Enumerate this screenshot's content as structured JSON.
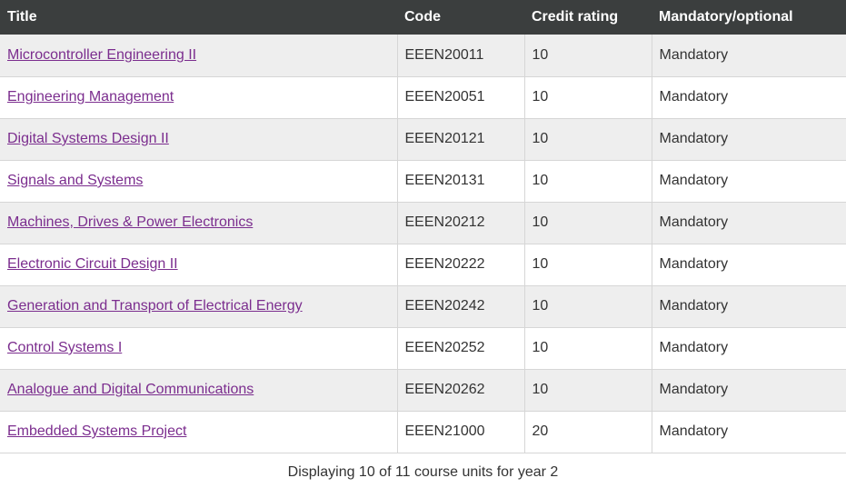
{
  "table": {
    "columns": [
      {
        "key": "title",
        "label": "Title"
      },
      {
        "key": "code",
        "label": "Code"
      },
      {
        "key": "credit",
        "label": "Credit rating"
      },
      {
        "key": "mand",
        "label": "Mandatory/optional"
      }
    ],
    "rows": [
      {
        "title": "Microcontroller Engineering II",
        "code": "EEEN20011",
        "credit": "10",
        "mand": "Mandatory"
      },
      {
        "title": "Engineering Management",
        "code": "EEEN20051",
        "credit": "10",
        "mand": "Mandatory"
      },
      {
        "title": "Digital Systems Design II",
        "code": "EEEN20121",
        "credit": "10",
        "mand": "Mandatory"
      },
      {
        "title": "Signals and Systems",
        "code": "EEEN20131",
        "credit": "10",
        "mand": "Mandatory"
      },
      {
        "title": "Machines, Drives & Power Electronics",
        "code": "EEEN20212",
        "credit": "10",
        "mand": "Mandatory"
      },
      {
        "title": "Electronic Circuit Design II",
        "code": "EEEN20222",
        "credit": "10",
        "mand": "Mandatory"
      },
      {
        "title": "Generation and Transport of Electrical Energy",
        "code": "EEEN20242",
        "credit": "10",
        "mand": "Mandatory"
      },
      {
        "title": "Control Systems I",
        "code": "EEEN20252",
        "credit": "10",
        "mand": "Mandatory"
      },
      {
        "title": "Analogue and Digital Communications",
        "code": "EEEN20262",
        "credit": "10",
        "mand": "Mandatory"
      },
      {
        "title": "Embedded Systems Project",
        "code": "EEEN21000",
        "credit": "20",
        "mand": "Mandatory"
      }
    ],
    "caption": "Displaying 10 of 11 course units for year 2"
  },
  "colors": {
    "header_background": "#3b3e3e",
    "header_text": "#ffffff",
    "link": "#7b2d8e",
    "stripe": "#eeeeee",
    "body_text": "#333333",
    "border": "#d6d6d6"
  }
}
